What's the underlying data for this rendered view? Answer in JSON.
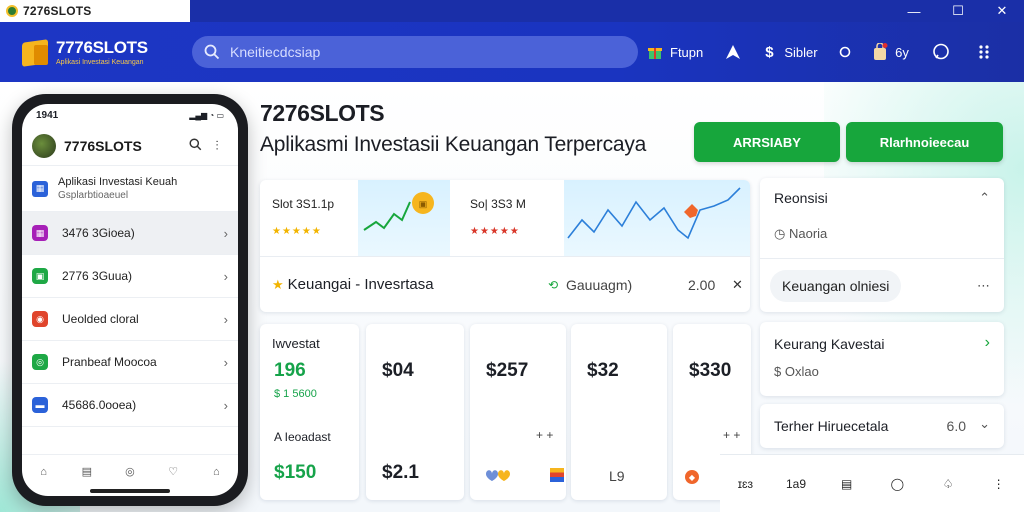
{
  "window": {
    "title": "7276SLOTS",
    "controls": [
      "—",
      "☐",
      "✕"
    ]
  },
  "header": {
    "brand_name": "7776SLOTS",
    "brand_tagline": "Aplikasi Investasi Keuangan",
    "search_placeholder": "Kneitiecdcsiap",
    "actions": [
      {
        "label": "Ftupn",
        "icon": "gift-icon"
      },
      {
        "label": "",
        "icon": "navigate-icon"
      },
      {
        "label": "Sibler",
        "icon": "dollar-icon"
      },
      {
        "label": "",
        "icon": "circle-icon"
      },
      {
        "label": "6y",
        "icon": "bag-icon"
      },
      {
        "label": "",
        "icon": "chat-icon"
      },
      {
        "label": "",
        "icon": "grid-icon"
      }
    ]
  },
  "hero": {
    "title": "7276SLOTS",
    "subtitle": "Aplikasmi Investasii Keuangan Terpercaya",
    "btn_primary": "ARRSIABY",
    "btn_secondary": "Rlarhnoieecau"
  },
  "phone": {
    "time": "1941",
    "signal": "▂▄▆ ◔ ▭",
    "brand": "7776SLOTS",
    "first_item": {
      "line1": "Aplikasi Investasi Keuah",
      "line2": "Gsplarbtioaeuel"
    },
    "rows": [
      {
        "label": "3476 3Gioea)",
        "color": "#a620b7",
        "icon": "▦"
      },
      {
        "label": "2776 3Guua)",
        "color": "#1ea845",
        "icon": "▣"
      },
      {
        "label": "Ueolded cloral",
        "color": "#e0452c",
        "icon": "◉"
      },
      {
        "label": "Pranbeaf Moocoa",
        "color": "#1ea845",
        "icon": "◎"
      },
      {
        "label": "45686.0ooea)",
        "color": "#2b62d9",
        "icon": "▬"
      }
    ],
    "tabs": [
      "⌂",
      "▤",
      "◎",
      "♡",
      "⌂"
    ]
  },
  "cards": {
    "slot1": {
      "name": "Slot 3S1.1p",
      "stars": "★★★★★"
    },
    "slot2": {
      "name": "So| 3S3 M",
      "stars": "★★★★★"
    },
    "row_label": "Keuangai - Invesrtasa",
    "row_status": "Gauuagm)",
    "row_value": "2.00",
    "row_close": "✕",
    "invest_title": "Iwvestat",
    "invest_value": "196",
    "invest_sub": "$ 1 5600",
    "invest_label2": "A Ieoadast",
    "invest_value2": "$150",
    "prices": [
      "$04",
      "$257",
      "$32",
      "$330"
    ],
    "price_bottom": "$2.1",
    "price_small": [
      "+ +",
      "L9",
      "+ +"
    ]
  },
  "right_panel": {
    "section1_title": "Reonsisi",
    "section1_sub": "Naoria",
    "pill": "Keuangan olniesi",
    "section2_title": "Keurang Kavestai",
    "section2_sub": "$ Oxlao",
    "section3_title": "Terher Hiruecetala",
    "section3_value": "6.0"
  },
  "bottom_bar": [
    "ɪɛɜ",
    "1a9",
    "▤",
    "◯",
    "♤",
    "⋮"
  ],
  "colors": {
    "brand_blue": "#1d36c4",
    "accent_green": "#17a63c",
    "gold": "#f6b51e"
  }
}
